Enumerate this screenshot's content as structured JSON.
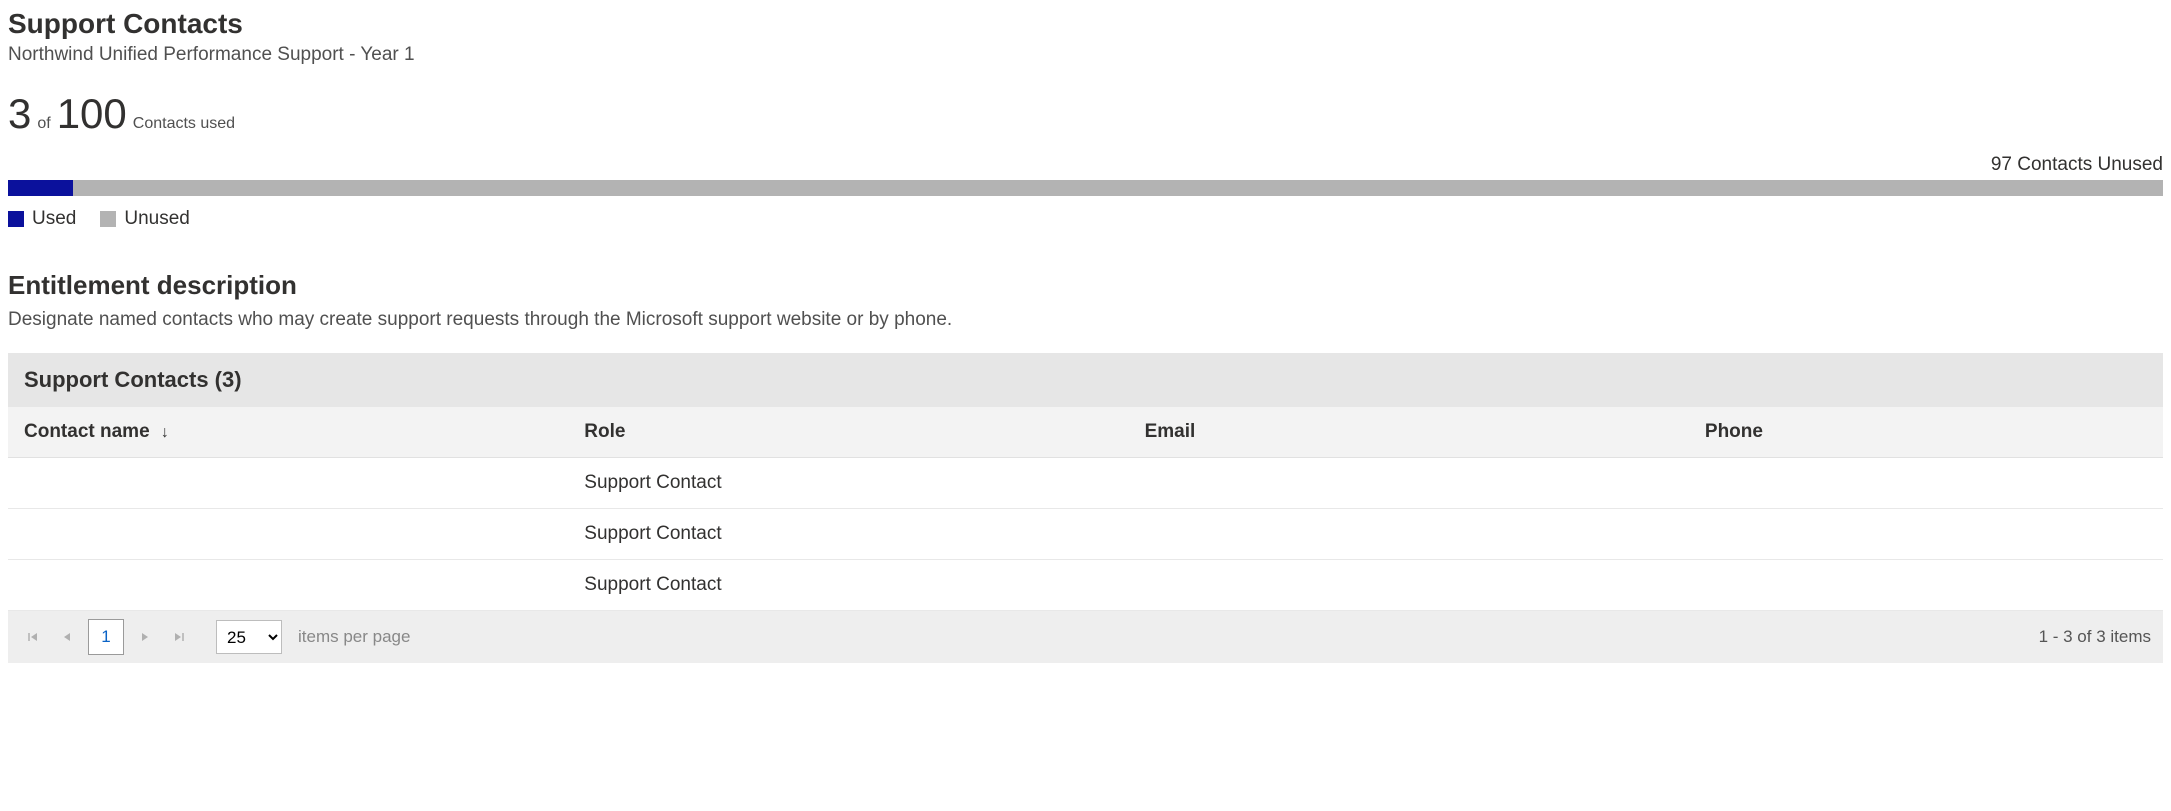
{
  "header": {
    "title": "Support Contacts",
    "subtitle": "Northwind Unified Performance Support - Year 1"
  },
  "usage": {
    "used_number": "3",
    "of_label": "of",
    "total_number": "100",
    "used_label": "Contacts used",
    "unused_text": "97 Contacts Unused",
    "used_percent": 3
  },
  "legend": {
    "used": "Used",
    "unused": "Unused"
  },
  "entitlement": {
    "heading": "Entitlement description",
    "description": "Designate named contacts who may create support requests through the Microsoft support website or by phone."
  },
  "table": {
    "panel_title": "Support Contacts (3)",
    "columns": {
      "name": "Contact name",
      "role": "Role",
      "email": "Email",
      "phone": "Phone"
    },
    "rows": [
      {
        "name": "",
        "role": "Support Contact",
        "email": "",
        "phone": ""
      },
      {
        "name": "",
        "role": "Support Contact",
        "email": "",
        "phone": ""
      },
      {
        "name": "",
        "role": "Support Contact",
        "email": "",
        "phone": ""
      }
    ]
  },
  "pager": {
    "current_page": "1",
    "page_size": "25",
    "per_page_label": "items per page",
    "range_text": "1 - 3 of 3 items"
  }
}
